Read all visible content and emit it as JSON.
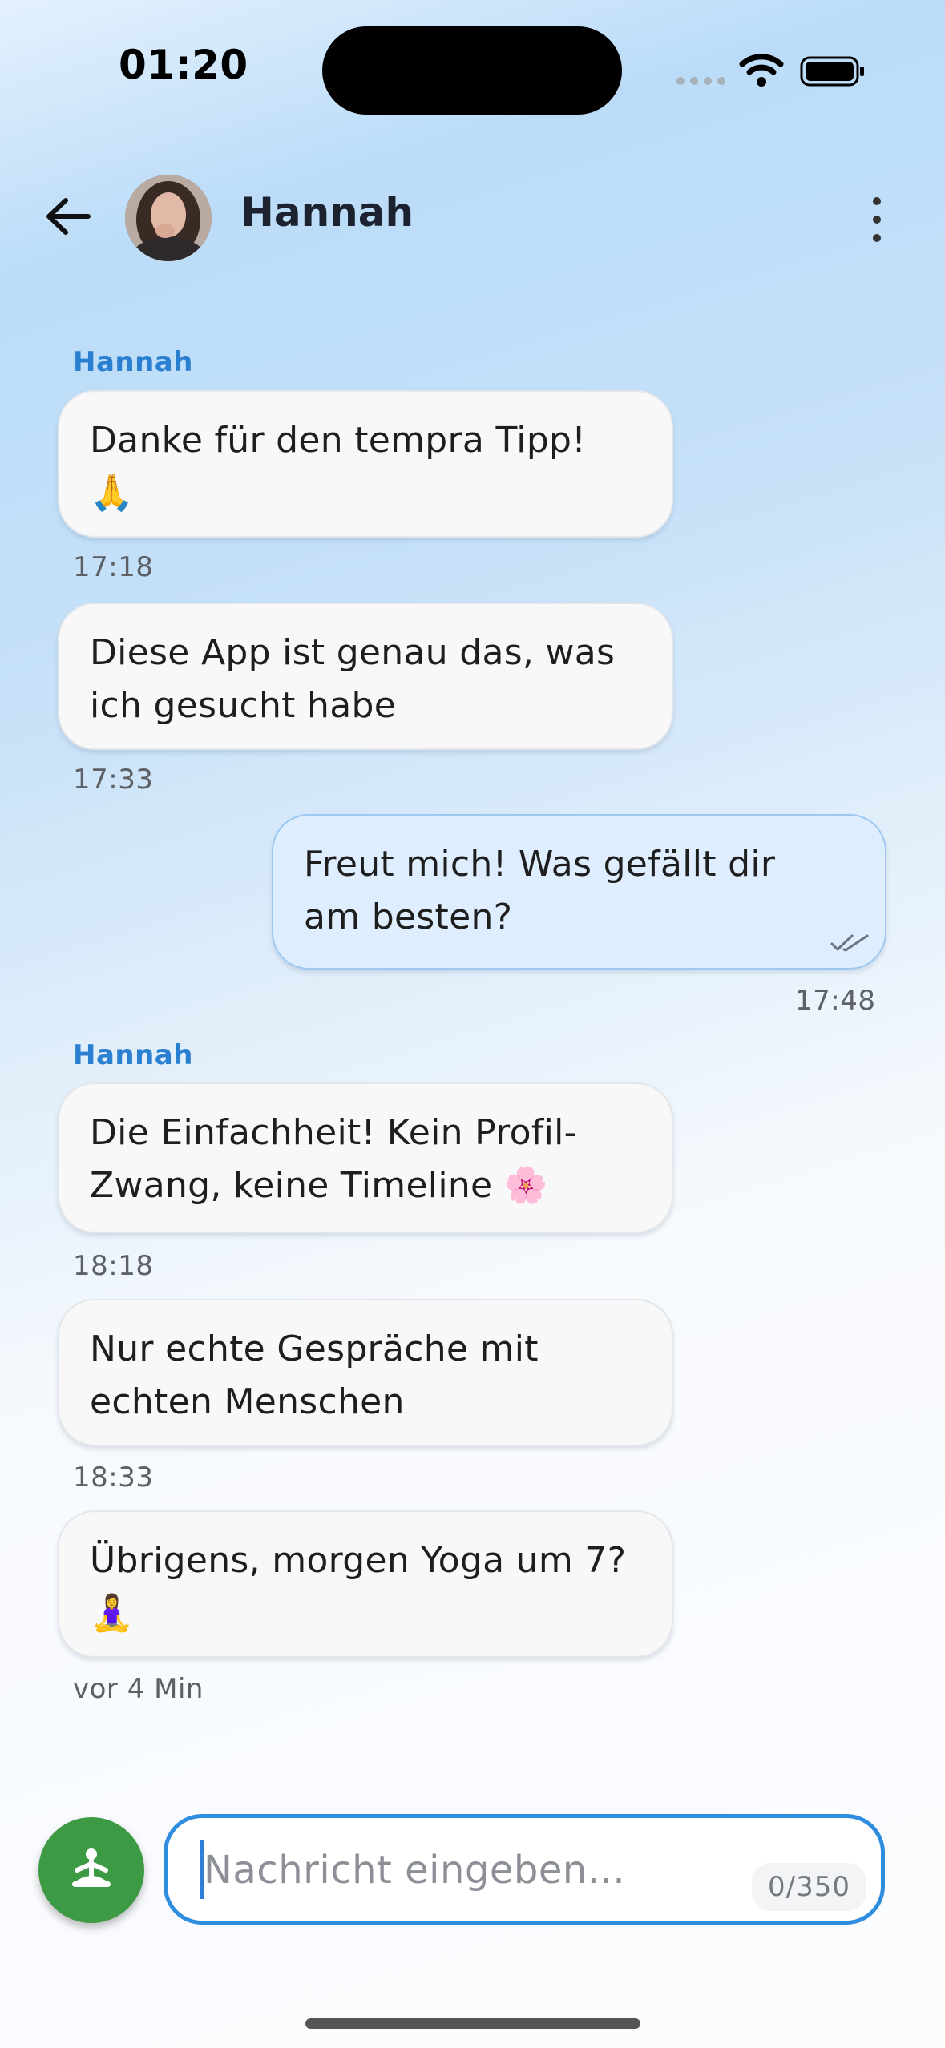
{
  "status_bar": {
    "time": "01:20"
  },
  "header": {
    "contact_name": "Hannah"
  },
  "messages": [
    {
      "sender": "Hannah",
      "direction": "in",
      "line1": "Danke für den tempra Tipp!",
      "line2": "🙏",
      "time": "17:18"
    },
    {
      "direction": "in",
      "line1": "Diese App ist genau das, was",
      "line2": "ich gesucht habe",
      "time": "17:33"
    },
    {
      "direction": "out",
      "line1": "Freut mich! Was gefällt dir",
      "line2": "am besten?",
      "time": "17:48",
      "read": true
    },
    {
      "sender": "Hannah",
      "direction": "in",
      "line1": "Die Einfachheit! Kein Profil-",
      "line2": "Zwang, keine Timeline 🌸",
      "time": "18:18"
    },
    {
      "direction": "in",
      "line1": "Nur echte Gespräche mit",
      "line2": "echten Menschen",
      "time": "18:33"
    },
    {
      "direction": "in",
      "line1": "Übrigens, morgen Yoga um 7?",
      "line2": "🧘‍♀️",
      "time": "vor 4 Min"
    }
  ],
  "composer": {
    "placeholder": "Nachricht eingeben...",
    "counter": "0/350",
    "action_icon": "yoga-icon",
    "accent_color": "#2f8de0",
    "action_color": "#3d9a44"
  }
}
